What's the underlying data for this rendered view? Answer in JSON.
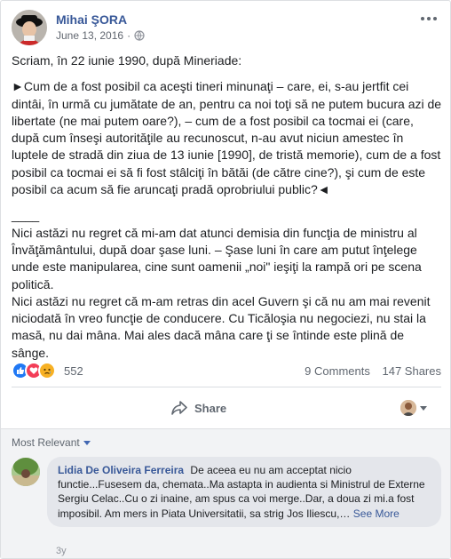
{
  "post": {
    "author": "Mihai ŞORA",
    "date": "June 13, 2016",
    "privacy_icon": "globe-icon",
    "paragraphs": [
      "Scriam, în 22 iunie 1990, după Mineriade:",
      "►Cum de a fost posibil ca aceşti tineri minunaţi – care, ei, s-au jertfit cei dintâi, în urmă cu jumătate de an, pentru ca noi toţi să ne putem bucura azi de libertate (ne mai putem oare?), – cum de a fost posibil ca tocmai ei (care, după cum înseşi autorităţile au recunoscut, n-au avut niciun amestec în luptele de stradă din ziua de 13 iunie [1990], de tristă memorie), cum de a fost posibil ca tocmai ei să fi fost stâlciţi în bătăi (de către cine?), şi cum de este posibil ca acum să fie aruncaţi pradă oprobriului public?◄",
      "____",
      "Nici astăzi nu regret că mi-am dat atunci demisia din funcţia de ministru al Învăţământului, după doar şase luni. – Şase luni în care am putut înţelege unde este manipularea, cine sunt oamenii „noi\" ieşiţi la rampă ori pe scena politică.",
      "Nici astăzi nu regret că m-am retras din acel Guvern şi că nu am mai revenit niciodată în vreo funcţie de conducere. Cu Ticăloşia nu negociezi, nu stai la masă, nu dai mâna. Mai ales dacă mâna care ţi se întinde este plină de sânge."
    ]
  },
  "stats": {
    "reaction_count": "552",
    "comments": "9 Comments",
    "shares": "147 Shares"
  },
  "actions": {
    "share_label": "Share"
  },
  "comments": {
    "sort_label": "Most Relevant",
    "items": [
      {
        "name": "Lidia De Oliveira Ferreira",
        "text": "De aceea eu nu am acceptat nicio functie...Fusesem da, chemata..Ma astapta in audienta si Ministrul de Externe Sergiu Celac..Cu o zi inaine, am spus ca voi merge..Dar, a doua zi mi.a fost imposibil. Am mers in Piata Universitatii, sa strig Jos Iliescu,…",
        "see_more": "See More",
        "time": "3y"
      }
    ]
  },
  "colors": {
    "link": "#385898",
    "like": "#2078f4",
    "love": "#f33e58",
    "sad": "#f7b125",
    "muted": "#606770"
  }
}
